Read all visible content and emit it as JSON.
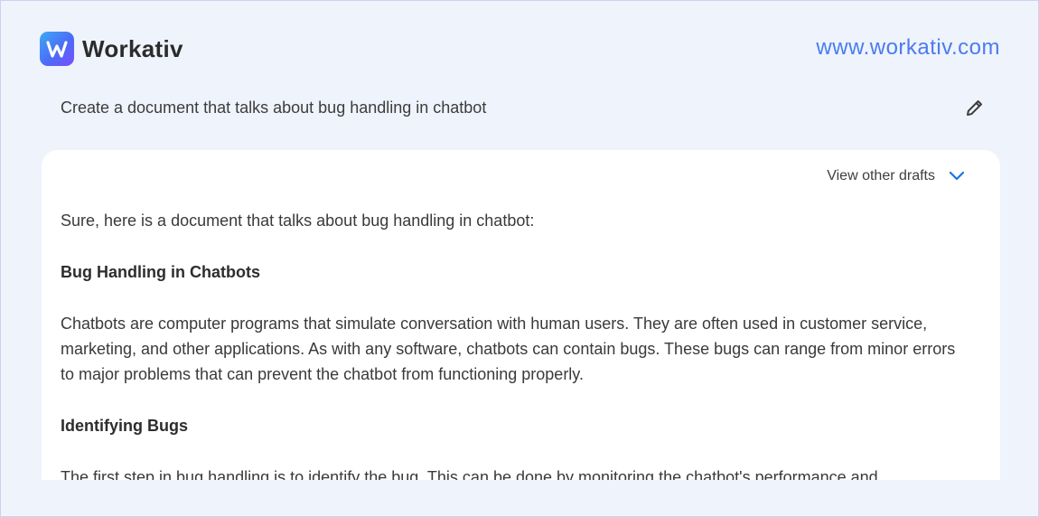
{
  "brand": {
    "name": "Workativ",
    "url": "www.workativ.com"
  },
  "prompt": {
    "text": "Create a document that talks about bug handling in chatbot"
  },
  "response": {
    "drafts_label": "View other drafts",
    "intro": "Sure, here is a document that talks about bug handling in chatbot:",
    "heading_1": "Bug Handling in Chatbots",
    "paragraph_1": "Chatbots are computer programs that simulate conversation with human users. They are often used in customer service, marketing, and other applications. As with any software, chatbots can contain bugs. These bugs can range from minor errors to major problems that can prevent the chatbot from functioning properly.",
    "heading_2": "Identifying Bugs",
    "paragraph_2": "The first step in bug handling is to identify the bug. This can be done by monitoring the chatbot's performance and"
  },
  "colors": {
    "accent": "#4b7bf0",
    "background": "#eff3fc",
    "card": "#ffffff",
    "chevron": "#1a73e8"
  },
  "icons": {
    "logo": "workativ-logo-icon",
    "edit": "pencil-icon",
    "drafts": "chevron-down-icon"
  }
}
